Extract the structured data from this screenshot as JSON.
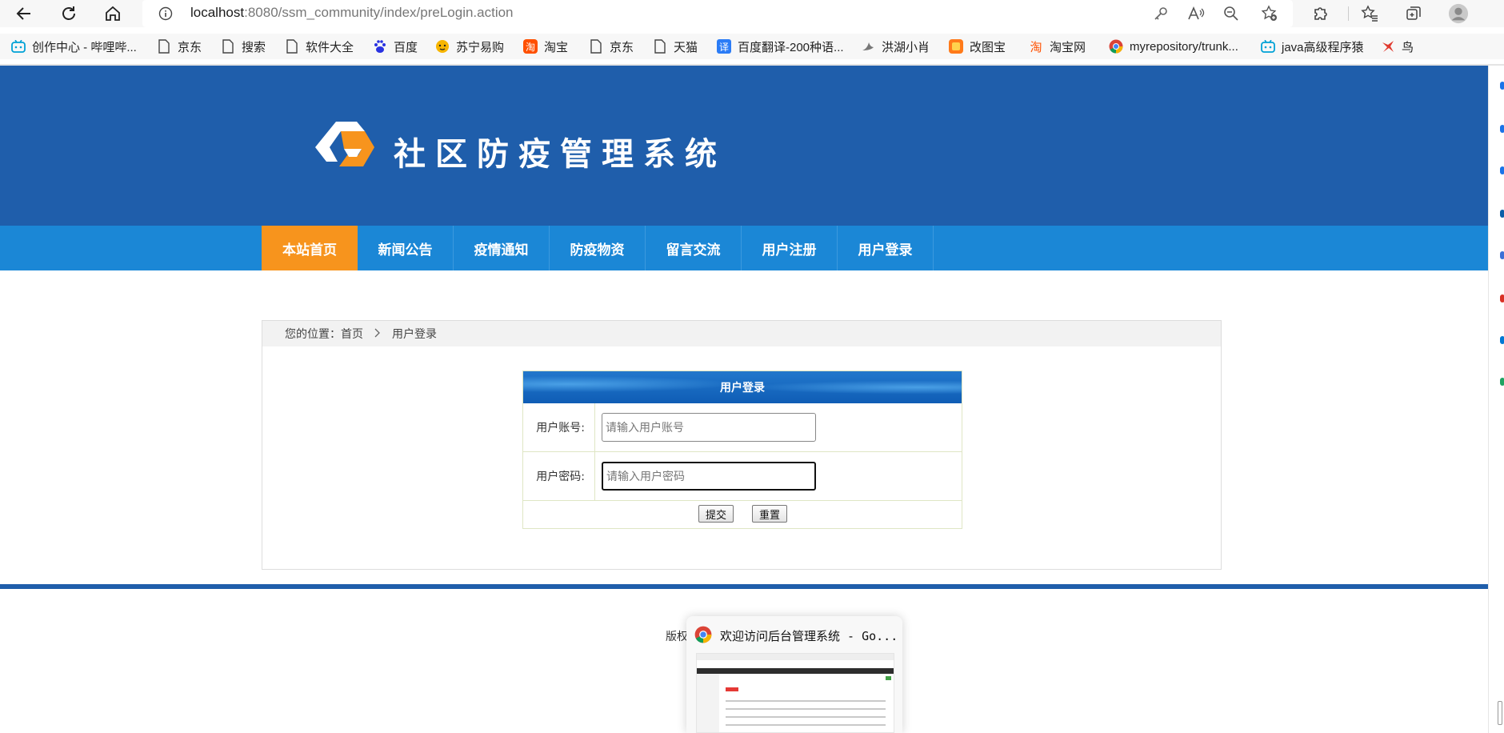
{
  "browser": {
    "url_host": "localhost",
    "url_rest": ":8080/ssm_community/index/preLogin.action",
    "bookmarks": [
      {
        "label": "创作中心 - 哔哩哔...",
        "icon": "bilibili-icon"
      },
      {
        "label": "京东",
        "icon": "page-icon"
      },
      {
        "label": "搜索",
        "icon": "page-icon"
      },
      {
        "label": "软件大全",
        "icon": "page-icon"
      },
      {
        "label": "百度",
        "icon": "baidu-icon"
      },
      {
        "label": "苏宁易购",
        "icon": "suning-icon"
      },
      {
        "label": "淘宝",
        "icon": "taobao-icon"
      },
      {
        "label": "京东",
        "icon": "page-icon"
      },
      {
        "label": "天猫",
        "icon": "page-icon"
      },
      {
        "label": "百度翻译-200种语...",
        "icon": "translate-icon"
      },
      {
        "label": "洪湖小肖",
        "icon": "bird-icon"
      },
      {
        "label": "改图宝",
        "icon": "gaitubao-icon"
      },
      {
        "label": "淘宝网",
        "icon": "taobao-icon"
      },
      {
        "label": "myrepository/trunk...",
        "icon": "chrome-icon"
      },
      {
        "label": "java高级程序猿",
        "icon": "bilibili-icon"
      },
      {
        "label": "鸟",
        "icon": "bird-icon"
      }
    ]
  },
  "site": {
    "title": "社区防疫管理系统",
    "nav": [
      "本站首页",
      "新闻公告",
      "疫情通知",
      "防疫物资",
      "留言交流",
      "用户注册",
      "用户登录"
    ],
    "breadcrumb": {
      "prefix": "您的位置：首页",
      "current": "用户登录"
    }
  },
  "login": {
    "heading": "用户登录",
    "account_label": "用户账号:",
    "account_placeholder": "请输入用户账号",
    "password_label": "用户密码:",
    "password_placeholder": "请输入用户密码",
    "submit_label": "提交",
    "reset_label": "重置"
  },
  "footer": {
    "copyright_partial": "版权"
  },
  "preview": {
    "title": "欢迎访问后台管理系统 - Go..."
  },
  "colors": {
    "header_blue": "#1f5eab",
    "nav_blue": "#1b87d6",
    "active_orange": "#f7941d"
  }
}
